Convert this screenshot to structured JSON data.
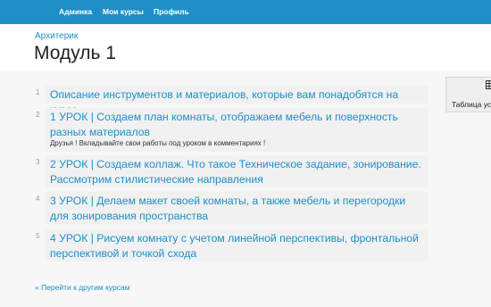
{
  "navbar": {
    "items": [
      {
        "label": "Админка"
      },
      {
        "label": "Мои курсы"
      },
      {
        "label": "Профиль"
      }
    ]
  },
  "header": {
    "breadcrumb": "Архитерик",
    "title": "Модуль 1"
  },
  "lessons": [
    {
      "number": "1",
      "title": "Описание инструментов и материалов, которые вам понадобятся на курсе"
    },
    {
      "number": "2",
      "title": "1 УРОК | Создаем план комнаты, отображаем мебель и поверхность разных материалов",
      "note": "Друзья ! Вкладывайте свои работы под уроком в комментариях !"
    },
    {
      "number": "3",
      "title": "2 УРОК | Создаем коллаж. Что такое Техническое задание, зонирование. Рассмотрим стилистические направления"
    },
    {
      "number": "4",
      "title": "3 УРОК | Делаем макет своей комнаты, а также мебель и перегородки для зонирования пространства"
    },
    {
      "number": "5",
      "title": "4 УРОК | Рисуем комнату с учетом линейной перспективы, фронтальной перспективой и точкой схода"
    }
  ],
  "back_link": "« Перейти к другим курсам",
  "side_card": {
    "icon": "table-icon",
    "label": "Таблица ус"
  }
}
